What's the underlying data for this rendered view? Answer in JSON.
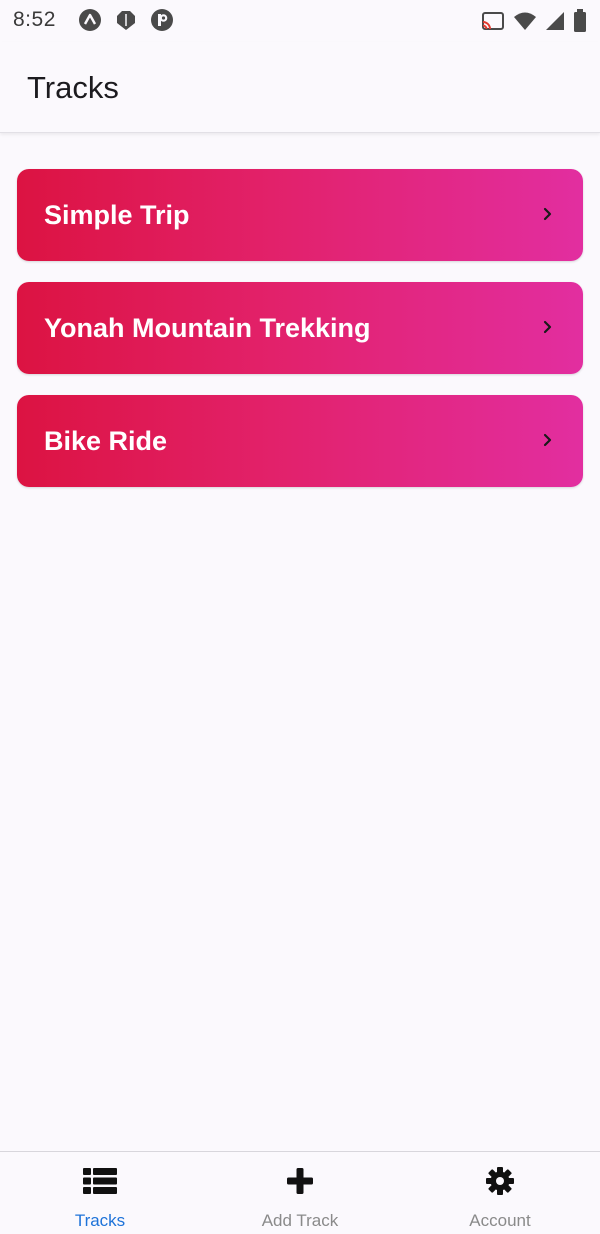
{
  "status_bar": {
    "time": "8:52",
    "left_icons": [
      "app-a-icon",
      "shield-icon",
      "app-p-icon"
    ],
    "right_icons": [
      "cast-icon",
      "wifi-icon",
      "signal-icon",
      "battery-icon"
    ]
  },
  "header": {
    "title": "Tracks"
  },
  "tracks": [
    {
      "name": "Simple Trip"
    },
    {
      "name": "Yonah Mountain Trekking"
    },
    {
      "name": "Bike Ride"
    }
  ],
  "bottom_nav": {
    "items": [
      {
        "label": "Tracks",
        "icon": "list-icon",
        "active": true
      },
      {
        "label": "Add Track",
        "icon": "plus-icon",
        "active": false
      },
      {
        "label": "Account",
        "icon": "gear-icon",
        "active": false
      }
    ]
  },
  "colors": {
    "background": "#fbf9fd",
    "card_gradient_start": "#dc1342",
    "card_gradient_end": "#e22ea0",
    "active_tab": "#1e73d9",
    "inactive_tab": "#8a8a8a"
  }
}
